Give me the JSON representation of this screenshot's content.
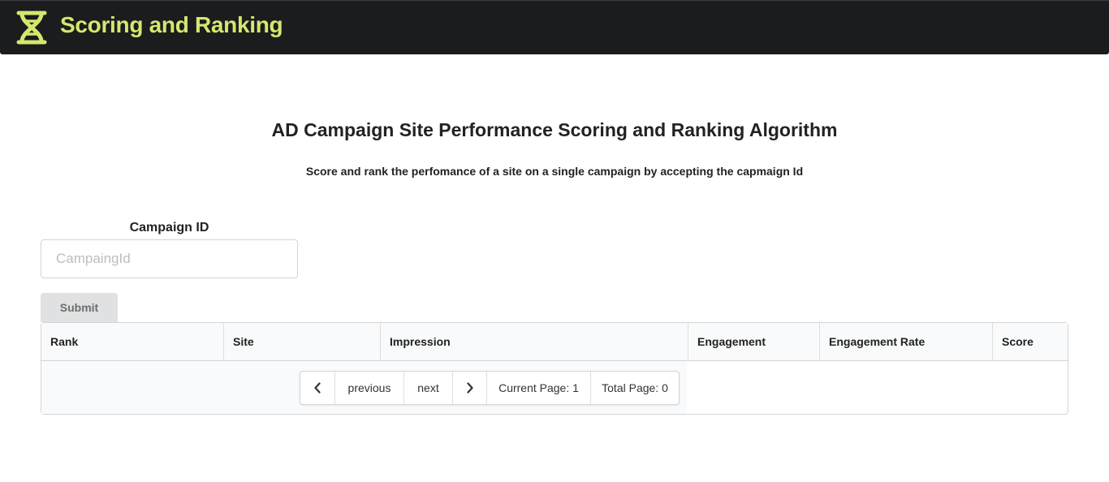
{
  "navbar": {
    "brand": "Scoring and Ranking",
    "logo_icon": "dna-icon",
    "logo_color": "#d4e86e",
    "background": "#1b1c1d"
  },
  "main": {
    "title": "AD Campaign Site Performance Scoring and Ranking Algorithm",
    "subtitle": "Score and rank the perfomance of a site on a single campaign by accepting the capmaign Id"
  },
  "form": {
    "label": "Campaign ID",
    "input_placeholder": "CampaingId",
    "input_value": "",
    "submit_label": "Submit"
  },
  "table": {
    "columns": [
      "Rank",
      "Site",
      "Impression",
      "Engagement",
      "Engagement Rate",
      "Score"
    ],
    "rows": []
  },
  "pagination": {
    "prev_icon": "chevron-left-icon",
    "previous_label": "previous",
    "next_label": "next",
    "next_icon": "chevron-right-icon",
    "current_page": "Current Page: 1",
    "total_page": "Total Page: 0"
  }
}
